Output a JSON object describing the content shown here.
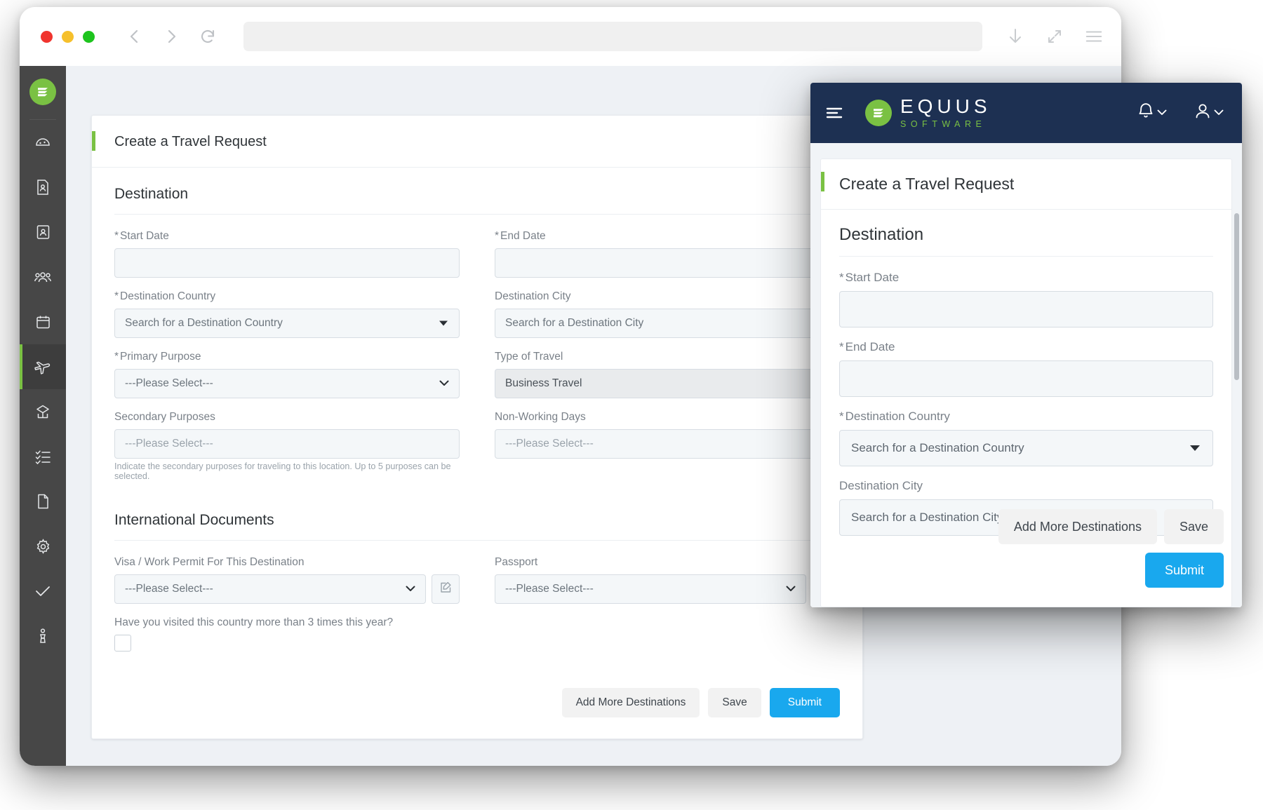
{
  "browser": {
    "traffic_lights": [
      "close",
      "minimize",
      "maximize"
    ],
    "back_icon": "back-chevron-icon",
    "forward_icon": "forward-chevron-icon",
    "reload_icon": "reload-icon",
    "url_value": "",
    "url_placeholder": "",
    "download_icon": "download-icon",
    "expand_icon": "expand-icon",
    "menu_icon": "hamburger-menu-icon"
  },
  "sidebar": {
    "logo_name": "equus-logo-icon",
    "items": [
      {
        "icon": "dashboard-gauge-icon",
        "active": false
      },
      {
        "icon": "document-person-icon",
        "active": false
      },
      {
        "icon": "clipboard-person-icon",
        "active": false
      },
      {
        "icon": "people-group-icon",
        "active": false
      },
      {
        "icon": "calendar-icon",
        "active": false
      },
      {
        "icon": "airplane-icon",
        "active": true
      },
      {
        "icon": "relocation-box-icon",
        "active": false
      },
      {
        "icon": "checklist-icon",
        "active": false
      },
      {
        "icon": "file-document-icon",
        "active": false
      },
      {
        "icon": "gear-icon",
        "active": false
      },
      {
        "icon": "checkmark-icon",
        "active": false
      },
      {
        "icon": "info-person-icon",
        "active": false
      }
    ]
  },
  "desktop_form": {
    "card_title": "Create a Travel Request",
    "sections": {
      "destination": "Destination",
      "international_documents": "International Documents"
    },
    "fields": {
      "start_date": {
        "label": "Start Date",
        "required": true,
        "value": ""
      },
      "end_date": {
        "label": "End Date",
        "required": true,
        "value": ""
      },
      "destination_country": {
        "label": "Destination Country",
        "required": true,
        "value": "Search for a Destination Country"
      },
      "destination_city": {
        "label": "Destination City",
        "required": false,
        "value": "Search for a Destination City"
      },
      "primary_purpose": {
        "label": "Primary Purpose",
        "required": true,
        "value": "---Please Select---"
      },
      "type_of_travel": {
        "label": "Type of Travel",
        "required": false,
        "value": "Business Travel"
      },
      "secondary_purposes": {
        "label": "Secondary Purposes",
        "required": false,
        "value": "---Please Select---"
      },
      "non_working_days": {
        "label": "Non-Working Days",
        "required": false,
        "value": "---Please Select---"
      },
      "visa_work_permit": {
        "label": "Visa / Work Permit For This Destination",
        "required": false,
        "value": "---Please Select---"
      },
      "passport": {
        "label": "Passport",
        "required": false,
        "value": "---Please Select---"
      },
      "visited_question": {
        "label": "Have you visited this country more than 3 times this year?",
        "checked": false
      }
    },
    "hint_secondary_purposes": "Indicate the secondary purposes for traveling to this location. Up to 5 purposes can be selected.",
    "buttons": {
      "add_more": "Add More Destinations",
      "save": "Save",
      "submit": "Submit"
    }
  },
  "mobile": {
    "brand": {
      "name": "EQUUS",
      "tagline": "SOFTWARE"
    },
    "burger_icon": "menu-collapse-icon",
    "bell_icon": "notifications-bell-icon",
    "user_icon": "user-account-icon",
    "card_title": "Create a Travel Request",
    "section_title": "Destination",
    "fields": {
      "start_date": {
        "label": "Start Date",
        "required": true,
        "value": ""
      },
      "end_date": {
        "label": "End Date",
        "required": true,
        "value": ""
      },
      "destination_country": {
        "label": "Destination Country",
        "required": true,
        "value": "Search for a Destination Country"
      },
      "destination_city": {
        "label": "Destination City",
        "required": false,
        "value": "Search for a Destination City"
      }
    },
    "buttons": {
      "add_more": "Add More Destinations",
      "save": "Save",
      "submit": "Submit"
    }
  },
  "colors": {
    "brand_green": "#7ac143",
    "brand_navy": "#1d3052",
    "primary_blue": "#19a8ee",
    "sidebar_dark": "#474747"
  }
}
